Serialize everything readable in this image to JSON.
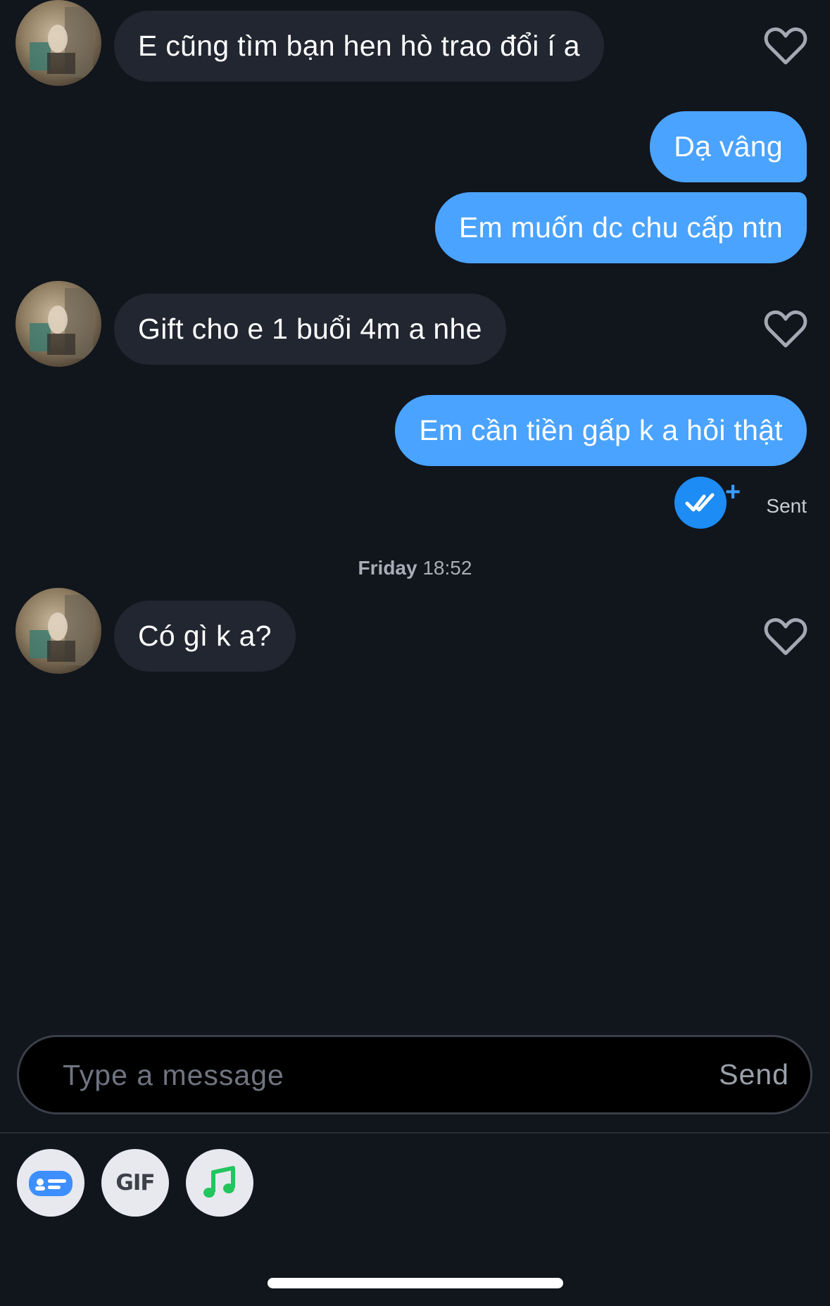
{
  "messages": [
    {
      "text": "E cũng tìm bạn hen hò trao đổi í a"
    },
    {
      "text": "Dạ vâng"
    },
    {
      "text": "Em muốn dc chu cấp ntn"
    },
    {
      "text": "Gift cho e 1 buổi 4m a nhe"
    },
    {
      "text": "Em cần tiền gấp k a hỏi thật"
    },
    {
      "text": "Có gì k a?"
    }
  ],
  "receipt": {
    "plus": "+",
    "status": "Sent"
  },
  "timestamp": {
    "day": "Friday",
    "time": "18:52"
  },
  "composer": {
    "placeholder": "Type a message",
    "send_label": "Send"
  },
  "tools": {
    "gif_label": "GIF"
  },
  "colors": {
    "background": "#11151c",
    "incoming_bubble": "#212630",
    "outgoing_bubble": "#4aa3ff",
    "read_badge": "#1d8cf5",
    "music_icon": "#22c55e"
  }
}
